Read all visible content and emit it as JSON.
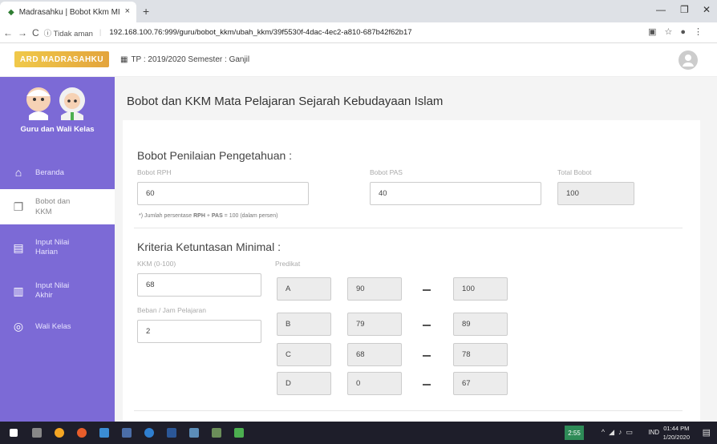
{
  "browser": {
    "tab_title": "Madrasahku | Bobot Kkm MI",
    "tab_close": "×",
    "new_tab": "+",
    "insecure_label": "ⓘ Tidak aman",
    "url": "192.168.100.76:999/guru/bobot_kkm/ubah_kkm/39f5530f-4dac-4ec2-a810-687b42f62b17"
  },
  "header": {
    "logo_text": "ARD MADRASAHKU",
    "tp_label": "TP : 2019/2020  Semester : Ganjil"
  },
  "sidebar": {
    "role": "Guru dan Wali Kelas",
    "items": [
      {
        "label": "Beranda",
        "icon": "home-icon"
      },
      {
        "label": "Bobot dan KKM",
        "icon": "layers-icon"
      },
      {
        "label": "Input Nilai Harian",
        "icon": "note-icon"
      },
      {
        "label": "Input Nilai Akhir",
        "icon": "document-icon"
      },
      {
        "label": "Wali Kelas",
        "icon": "user-circle-icon"
      }
    ]
  },
  "main": {
    "title": "Bobot dan KKM Mata Pelajaran Sejarah Kebudayaan Islam",
    "bobot": {
      "section_title": "Bobot Penilaian Pengetahuan :",
      "rph_label": "Bobot RPH",
      "rph_value": "60",
      "pas_label": "Bobot PAS",
      "pas_value": "40",
      "total_label": "Total Bobot",
      "total_value": "100",
      "note_prefix": "*) Jumlah persentase ",
      "note_rph": "RPH",
      "note_plus": " + ",
      "note_pas": "PAS",
      "note_suffix": " = 100 (dalam persen)"
    },
    "kkm": {
      "section_title": "Kriteria Ketuntasan Minimal :",
      "kkm_label": "KKM (0-100)",
      "kkm_value": "68",
      "beban_label": "Beban / Jam Pelajaran",
      "beban_value": "2",
      "predikat_label": "Predikat",
      "predikat": [
        {
          "grade": "A",
          "min": "90",
          "max": "100"
        },
        {
          "grade": "B",
          "min": "79",
          "max": "89"
        },
        {
          "grade": "C",
          "min": "68",
          "max": "78"
        },
        {
          "grade": "D",
          "min": "0",
          "max": "67"
        }
      ]
    }
  },
  "taskbar": {
    "tray_app": "2:55",
    "lang": "IND",
    "time": "01:44 PM",
    "date": "1/20/2020"
  },
  "colors": {
    "sidebar": "#7c6ad6",
    "logo": "#e3a43c",
    "taskbar": "#1e1e2a"
  }
}
